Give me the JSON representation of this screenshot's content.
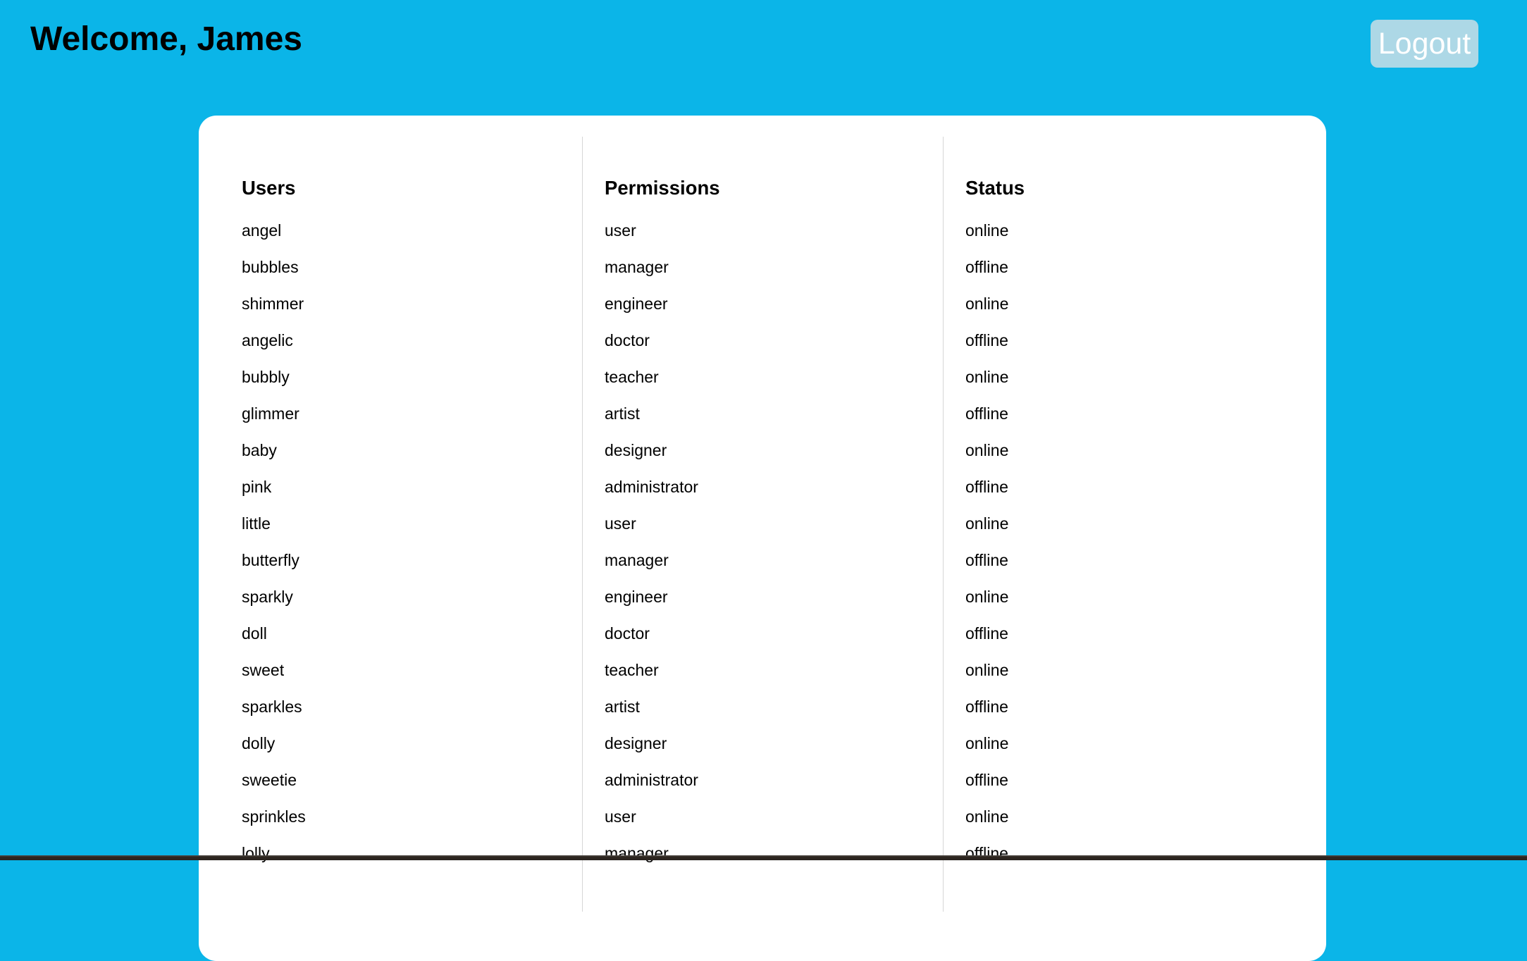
{
  "header": {
    "welcome_text": "Welcome, James",
    "logout_label": "Logout"
  },
  "colors": {
    "page_background": "#0BB5E8",
    "logout_background": "#ADD8E6",
    "card_background": "#FFFFFF"
  },
  "table": {
    "columns": [
      {
        "heading": "Users",
        "items": [
          "angel",
          "bubbles",
          "shimmer",
          "angelic",
          "bubbly",
          "glimmer",
          "baby",
          "pink",
          "little",
          "butterfly",
          "sparkly",
          "doll",
          "sweet",
          "sparkles",
          "dolly",
          "sweetie",
          "sprinkles",
          "lolly"
        ]
      },
      {
        "heading": "Permissions",
        "items": [
          "user",
          "manager",
          "engineer",
          "doctor",
          "teacher",
          "artist",
          "designer",
          "administrator",
          "user",
          "manager",
          "engineer",
          "doctor",
          "teacher",
          "artist",
          "designer",
          "administrator",
          "user",
          "manager"
        ]
      },
      {
        "heading": "Status",
        "items": [
          "online",
          "offline",
          "online",
          "offline",
          "online",
          "offline",
          "online",
          "offline",
          "online",
          "offline",
          "online",
          "offline",
          "online",
          "offline",
          "online",
          "offline",
          "online",
          "offline"
        ]
      }
    ]
  }
}
